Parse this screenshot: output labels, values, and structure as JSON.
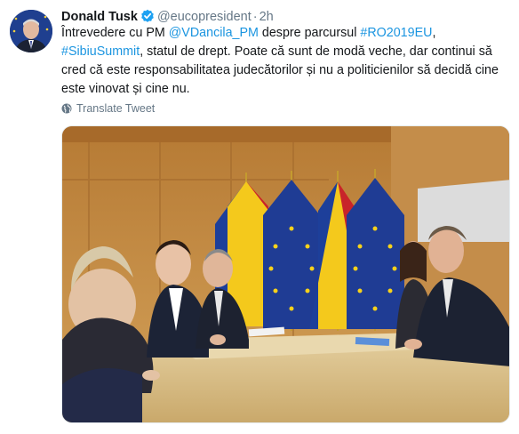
{
  "author": {
    "name": "Donald Tusk",
    "handle": "@eucopresident",
    "separator": "·",
    "time": "2h",
    "verified_icon": "verified-badge-icon",
    "avatar_icon": "avatar-photo"
  },
  "tweet": {
    "text_line1_a": "Întrevedere cu PM ",
    "mention": "@VDancila_PM",
    "text_line1_b": " despre parcursul ",
    "hashtag1": "#RO2019EU",
    "comma": ", ",
    "hashtag2": "#SibiuSummit",
    "text_rest": ", statul de drept. Poate că sunt de modă veche, dar continui să cred că este responsabilitatea judecătorilor și nu a politicienilor să decidă cine este vinovat și cine nu."
  },
  "translate": {
    "label": "Translate Tweet",
    "icon": "globe-icon"
  },
  "media": {
    "icon": "photo-meeting",
    "colors": {
      "wall": "#c58a3c",
      "table": "#d9c08a",
      "eu_blue": "#1f3c94",
      "eu_star": "#f7d21a",
      "ro_blue": "#1d3f9a",
      "ro_yellow": "#f4c91c",
      "ro_red": "#c8242a",
      "suit": "#1d2230"
    }
  },
  "colors": {
    "link": "#1b95e0",
    "muted": "#657786",
    "text": "#14171a"
  }
}
